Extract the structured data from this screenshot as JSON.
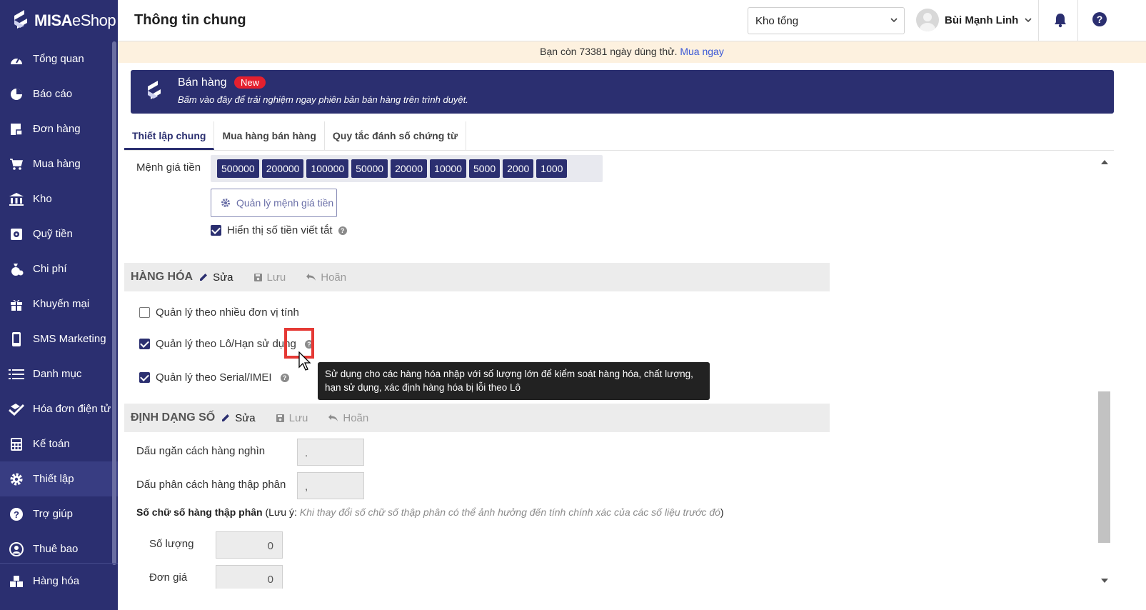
{
  "app": {
    "brand_bold": "MISA",
    "brand_thin": "eShop"
  },
  "sidebar": {
    "items": [
      {
        "label": "Tổng quan",
        "icon": "dashboard-icon"
      },
      {
        "label": "Báo cáo",
        "icon": "pie-chart-icon"
      },
      {
        "label": "Đơn hàng",
        "icon": "order-icon"
      },
      {
        "label": "Mua hàng",
        "icon": "cart-icon"
      },
      {
        "label": "Kho",
        "icon": "warehouse-icon"
      },
      {
        "label": "Quỹ tiền",
        "icon": "safe-icon"
      },
      {
        "label": "Chi phí",
        "icon": "money-bag-icon"
      },
      {
        "label": "Khuyến mại",
        "icon": "gift-icon"
      },
      {
        "label": "SMS Marketing",
        "icon": "phone-icon"
      },
      {
        "label": "Danh mục",
        "icon": "list-icon"
      },
      {
        "label": "Hóa đơn điện tử",
        "icon": "invoice-icon"
      },
      {
        "label": "Kế toán",
        "icon": "calculator-icon"
      },
      {
        "label": "Thiết lập",
        "icon": "gear-icon"
      },
      {
        "label": "Trợ giúp",
        "icon": "help-icon"
      },
      {
        "label": "Thuê bao",
        "icon": "user-icon"
      }
    ],
    "bottom_item": {
      "label": "Hàng hóa",
      "icon": "goods-icon"
    }
  },
  "header": {
    "title": "Thông tin chung",
    "store_select": "Kho tổng",
    "user_name": "Bùi Mạnh Linh"
  },
  "trial": {
    "text": "Bạn còn 73381 ngày dùng thử.",
    "link": "Mua ngay"
  },
  "promo": {
    "title": "Bán hàng",
    "badge": "New",
    "desc": "Bấm vào đây để trải nghiệm ngay phiên bản bán hàng trên trình duyệt."
  },
  "tabs": [
    "Thiết lập chung",
    "Mua hàng bán hàng",
    "Quy tắc đánh số chứng từ"
  ],
  "denomination": {
    "label": "Mệnh giá tiền",
    "values": [
      "500000",
      "200000",
      "100000",
      "50000",
      "20000",
      "10000",
      "5000",
      "2000",
      "1000"
    ],
    "manage_button": "Quản lý mệnh giá tiền",
    "short_amount_label": "Hiển thị số tiền viết tắt",
    "short_amount_checked": true
  },
  "goods_section": {
    "title": "HÀNG HÓA",
    "edit": "Sửa",
    "save": "Lưu",
    "cancel": "Hoãn",
    "options": [
      {
        "label": "Quản lý theo nhiều đơn vị tính",
        "checked": false
      },
      {
        "label": "Quản lý theo Lô/Hạn sử dụng",
        "checked": true
      },
      {
        "label": "Quản lý theo Serial/IMEI",
        "checked": true
      }
    ]
  },
  "tooltip": {
    "text": "Sử dụng cho các hàng hóa nhập với số lượng lớn để kiểm soát hàng hóa, chất lượng, hạn sử dụng, xác định hàng hóa bị lỗi theo Lô"
  },
  "number_section": {
    "title": "ĐỊNH DẠNG SỐ",
    "edit": "Sửa",
    "save": "Lưu",
    "cancel": "Hoãn",
    "thousand_sep_label": "Dấu ngăn cách hàng nghìn",
    "thousand_sep_value": ".",
    "decimal_sep_label": "Dấu phân cách hàng thập phân",
    "decimal_sep_value": ",",
    "decimal_digits_label": "Số chữ số hàng thập phân",
    "decimal_note_prefix": "(Lưu ý:",
    "decimal_note": "Khi thay đổi số chữ số thập phân có thể ảnh hưởng đến tính chính xác của các số liệu trước đó",
    "decimal_note_suffix": ")",
    "quantity_label": "Số lượng",
    "quantity_value": "0",
    "unit_price_label": "Đơn giá",
    "unit_price_value": "0"
  },
  "colors": {
    "brand": "#2b2f70",
    "badge": "#e5202e",
    "link": "#3b58d6",
    "highlight": "#e53935"
  }
}
